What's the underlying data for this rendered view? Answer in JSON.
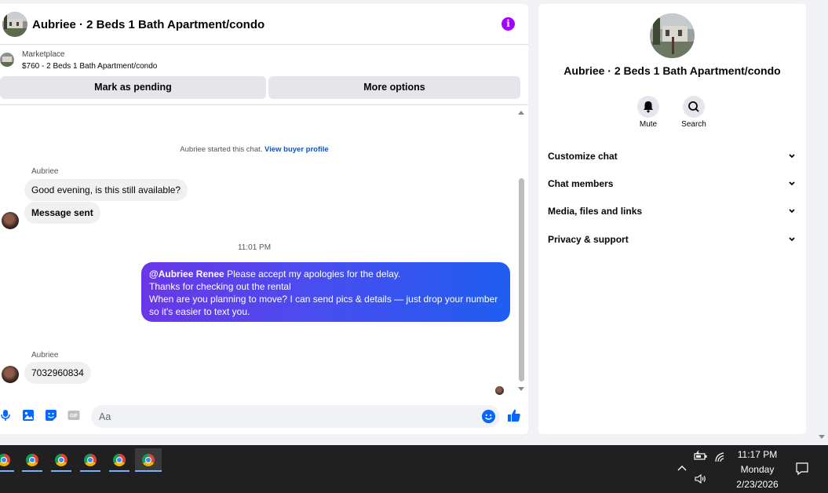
{
  "chat": {
    "title": "Aubriee · 2 Beds 1 Bath Apartment/condo",
    "info_icon": "i",
    "listing_source": "Marketplace",
    "listing_price": "$760 - 2 Beds 1 Bath Apartment/condo",
    "mark_pending_label": "Mark as pending",
    "more_options_label": "More options",
    "system_text": "Aubriee started this chat.",
    "system_link": "View buyer profile",
    "timestamp": "11:01 PM",
    "messages": [
      {
        "sender": "Aubriee",
        "text": "Good evening, is this still available?"
      },
      {
        "text": "Message sent"
      },
      {
        "mention": "@Aubriee Renee",
        "lines": [
          "Please accept my apologies for the delay.",
          "Thanks for checking out the rental",
          "When are you planning to move? I can send pics & details — just drop your number",
          "so it's easier to text you."
        ]
      },
      {
        "sender": "Aubriee",
        "text": "7032960834"
      }
    ],
    "composer_placeholder": "Aa"
  },
  "info": {
    "name": "Aubriee · 2 Beds 1 Bath Apartment/condo",
    "mute_label": "Mute",
    "search_label": "Search",
    "sections": [
      "Customize chat",
      "Chat members",
      "Media, files and links",
      "Privacy & support"
    ]
  },
  "taskbar": {
    "time": "11:17 PM",
    "day": "Monday",
    "date": "2/23/2026"
  },
  "colors": {
    "accent": "#0866ff",
    "outgoing_start": "#6a37e8",
    "outgoing_end": "#1e5ef0",
    "info_icon": "#a200ff",
    "taskbar": "#202020"
  }
}
